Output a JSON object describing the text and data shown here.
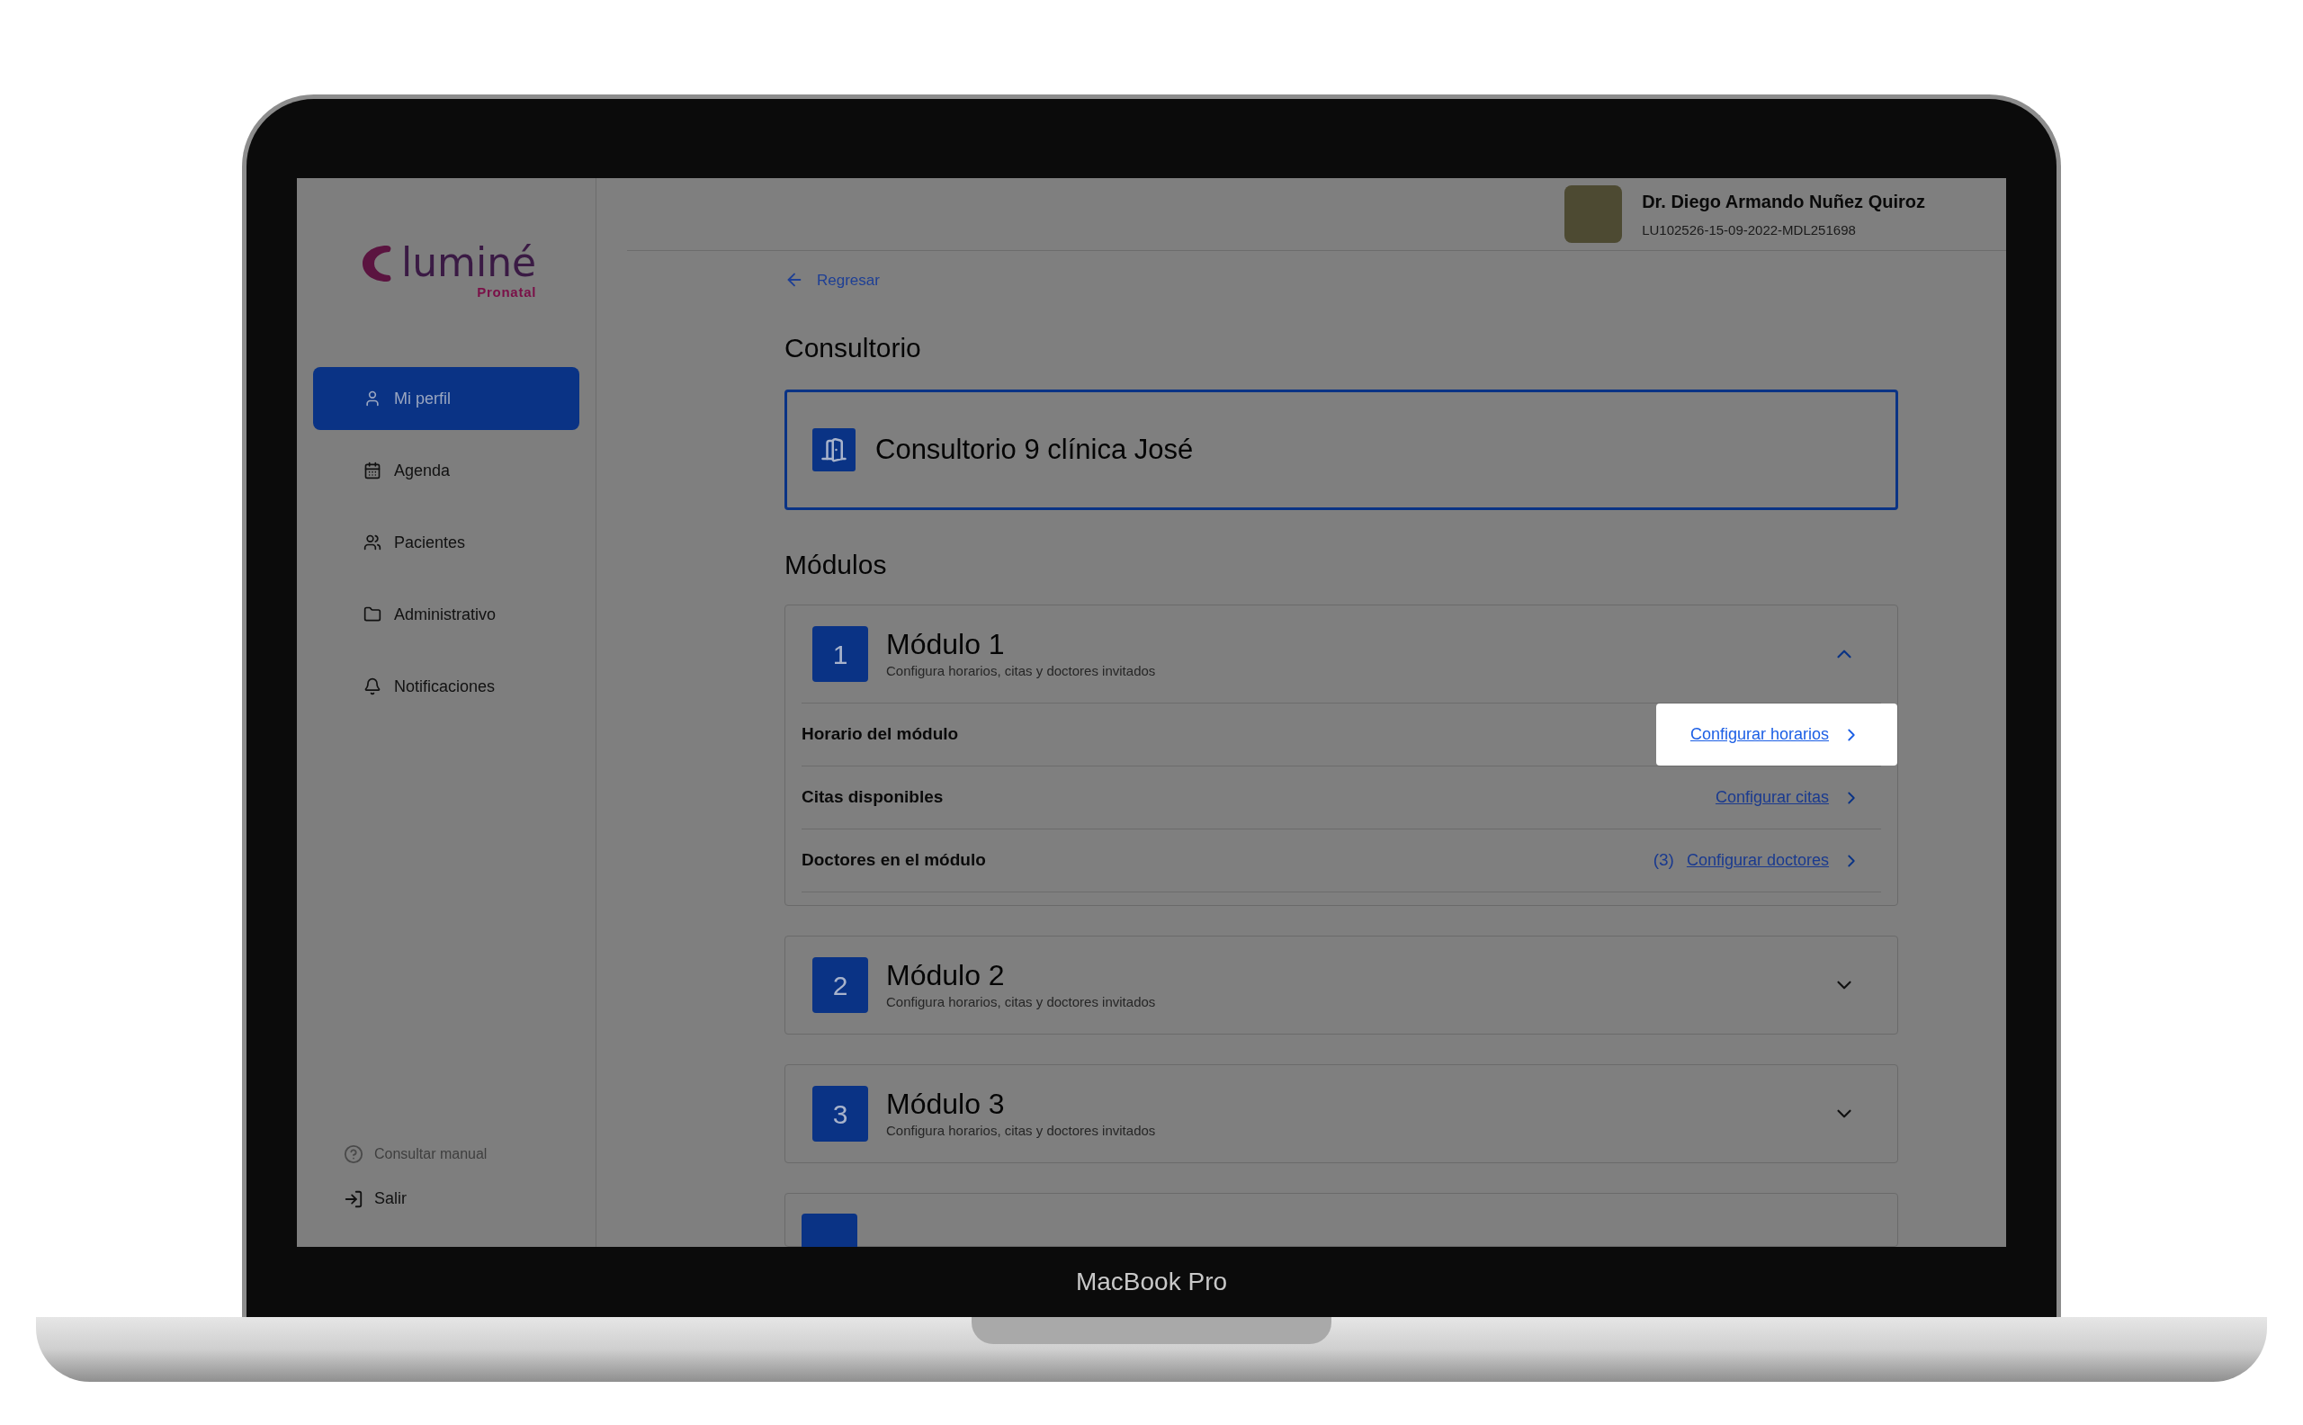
{
  "device": {
    "label": "MacBook Pro"
  },
  "sidebar": {
    "logo": {
      "name": "luminé",
      "tagline": "Pronatal"
    },
    "items": [
      {
        "label": "Mi perfil",
        "selected": true
      },
      {
        "label": "Agenda",
        "selected": false
      },
      {
        "label": "Pacientes",
        "selected": false
      },
      {
        "label": "Administrativo",
        "selected": false
      },
      {
        "label": "Notificaciones",
        "selected": false
      }
    ],
    "footer": [
      {
        "label": "Consultar manual",
        "disabled": true
      },
      {
        "label": "Salir",
        "disabled": false
      }
    ]
  },
  "header": {
    "user_name": "Dr. Diego Armando Nuñez Quiroz",
    "user_id": "LU102526-15-09-2022-MDL251698"
  },
  "back_link": "Regresar",
  "section_title": "Consultorio",
  "office": "Consultorio 9 clínica José",
  "modules_title": "Módulos",
  "modules": [
    {
      "number": "1",
      "title": "Módulo 1",
      "subtitle": "Configura horarios, citas y doctores invitados",
      "expanded": true,
      "rows": [
        {
          "label": "Horario del módulo",
          "link": "Configurar horarios",
          "highlighted": true
        },
        {
          "label": "Citas disponibles",
          "link": "Configurar citas",
          "highlighted": false
        },
        {
          "label": "Doctores en el módulo",
          "count": "(3)",
          "link": "Configurar doctores",
          "highlighted": false
        }
      ]
    },
    {
      "number": "2",
      "title": "Módulo 2",
      "subtitle": "Configura horarios, citas y doctores invitados",
      "expanded": false
    },
    {
      "number": "3",
      "title": "Módulo 3",
      "subtitle": "Configura horarios, citas y doctores invitados",
      "expanded": false
    }
  ]
}
